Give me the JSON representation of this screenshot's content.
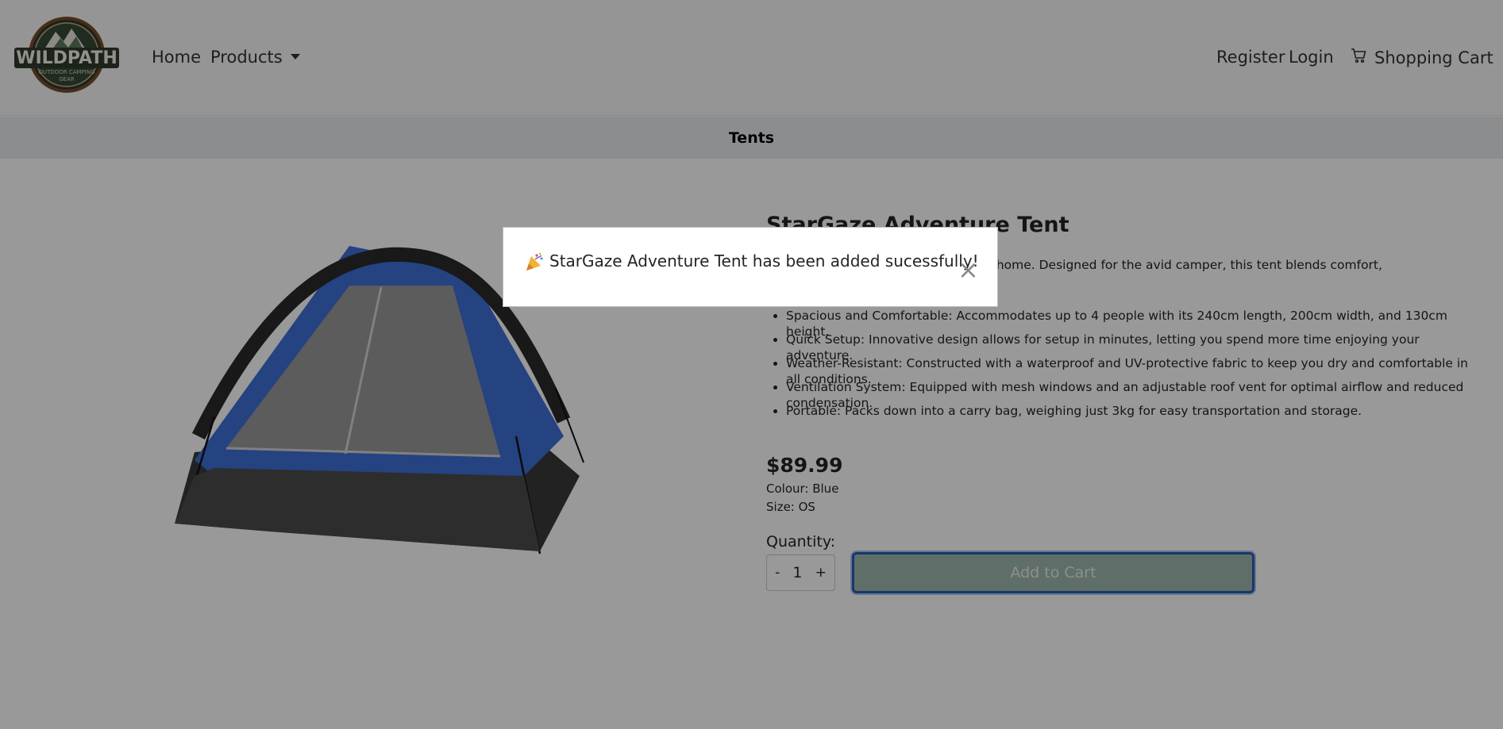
{
  "header": {
    "logo_alt": "WILDPATH OUTDOOR CAMPING GEAR",
    "nav": {
      "home": "Home",
      "products": "Products",
      "register": "Register",
      "login": "Login",
      "cart": "Shopping Cart"
    }
  },
  "category": "Tents",
  "product": {
    "title": "StarGaze Adventure Tent",
    "description_visible": "table home away from home. Designed for the avid camper, this tent blends comfort,",
    "features": [
      "Spacious and Comfortable: Accommodates up to 4 people with its 240cm length, 200cm width, and 130cm height.",
      "Quick Setup: Innovative design allows for setup in minutes, letting you spend more time enjoying your adventure.",
      "Weather-Resistant: Constructed with a waterproof and UV-protective fabric to keep you dry and comfortable in all conditions.",
      "Ventilation System: Equipped with mesh windows and an adjustable roof vent for optimal airflow and reduced condensation.",
      "Portable: Packs down into a carry bag, weighing just 3kg for easy transportation and storage."
    ],
    "price": "$89.99",
    "colour": "Colour: Blue",
    "size": "Size: OS",
    "quantity_label": "Quantity:",
    "quantity": "1",
    "minus": "-",
    "plus": "+",
    "add_to_cart": "Add to Cart"
  },
  "toast": {
    "message": "StarGaze Adventure Tent has been added sucessfully!",
    "close": "×",
    "icon": "party-popper-icon"
  },
  "colors": {
    "button_fill": "#9fb7b0",
    "button_border": "#2a5db0",
    "tent_blue": "#3f6fd8"
  }
}
